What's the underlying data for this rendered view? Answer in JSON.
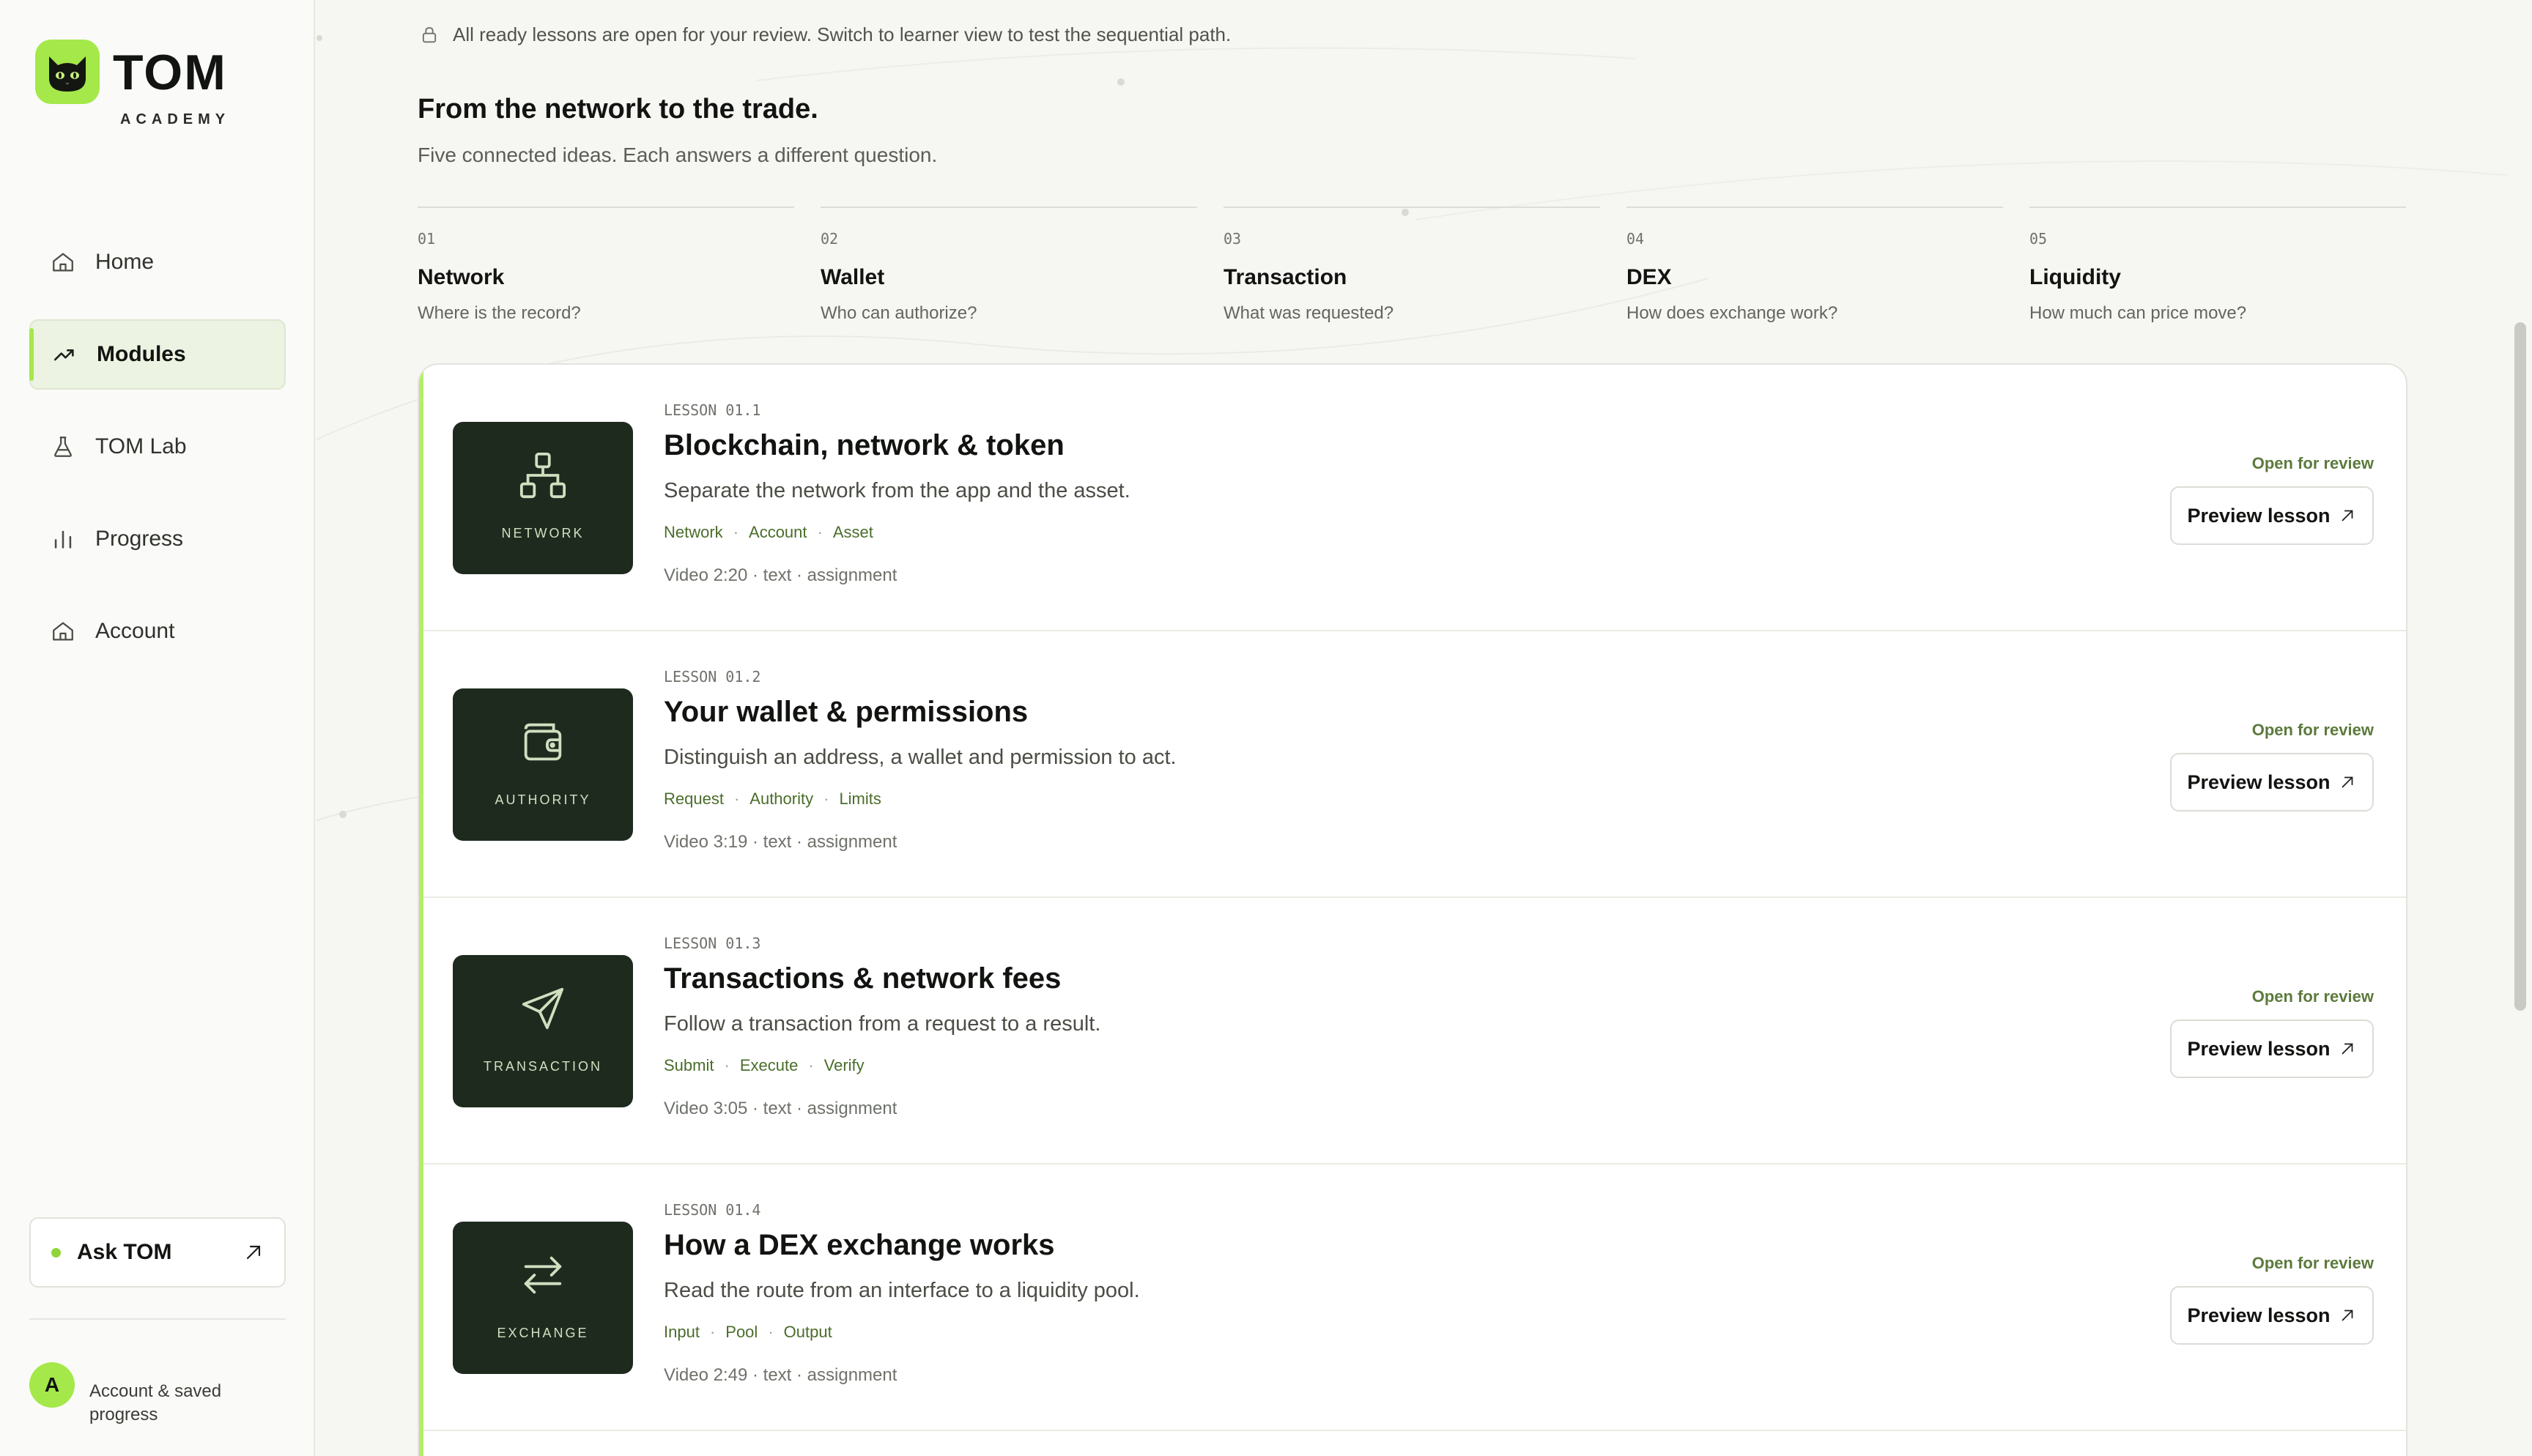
{
  "brand": {
    "name": "TOM",
    "subtitle": "ACADEMY",
    "accent": "#a4e84a"
  },
  "sidebar": {
    "items": [
      {
        "label": "Home",
        "icon": "home-icon",
        "active": false
      },
      {
        "label": "Modules",
        "icon": "trending-up-icon",
        "active": true
      },
      {
        "label": "TOM Lab",
        "icon": "flask-icon",
        "active": false
      },
      {
        "label": "Progress",
        "icon": "bar-chart-icon",
        "active": false
      },
      {
        "label": "Account",
        "icon": "home-icon",
        "active": false
      }
    ],
    "ask": {
      "label": "Ask TOM",
      "icon": "arrow-up-right-icon"
    },
    "account": {
      "avatar_initial": "A",
      "label": "Account & saved progress"
    }
  },
  "notice": {
    "icon": "lock-icon",
    "text": "All ready lessons are open for your review. Switch to learner view to test the sequential path."
  },
  "section": {
    "title": "From the network to the trade.",
    "subtitle": "Five connected ideas. Each answers a different question."
  },
  "steps": [
    {
      "num": "01",
      "title": "Network",
      "question": "Where is the record?"
    },
    {
      "num": "02",
      "title": "Wallet",
      "question": "Who can authorize?"
    },
    {
      "num": "03",
      "title": "Transaction",
      "question": "What was requested?"
    },
    {
      "num": "04",
      "title": "DEX",
      "question": "How does exchange work?"
    },
    {
      "num": "05",
      "title": "Liquidity",
      "question": "How much can price move?"
    }
  ],
  "lessons": [
    {
      "code": "LESSON 01.1",
      "title": "Blockchain, network & token",
      "description": "Separate the network from the app and the asset.",
      "tags": [
        "Network",
        "Account",
        "Asset"
      ],
      "meta": "Video 2:20 · text · assignment",
      "tile_label": "NETWORK",
      "tile_icon": "network-icon",
      "status": "Open for review",
      "button": "Preview lesson"
    },
    {
      "code": "LESSON 01.2",
      "title": "Your wallet & permissions",
      "description": "Distinguish an address, a wallet and permission to act.",
      "tags": [
        "Request",
        "Authority",
        "Limits"
      ],
      "meta": "Video 3:19 · text · assignment",
      "tile_label": "AUTHORITY",
      "tile_icon": "wallet-icon",
      "status": "Open for review",
      "button": "Preview lesson"
    },
    {
      "code": "LESSON 01.3",
      "title": "Transactions & network fees",
      "description": "Follow a transaction from a request to a result.",
      "tags": [
        "Submit",
        "Execute",
        "Verify"
      ],
      "meta": "Video 3:05 · text · assignment",
      "tile_label": "TRANSACTION",
      "tile_icon": "send-icon",
      "status": "Open for review",
      "button": "Preview lesson"
    },
    {
      "code": "LESSON 01.4",
      "title": "How a DEX exchange works",
      "description": "Read the route from an interface to a liquidity pool.",
      "tags": [
        "Input",
        "Pool",
        "Output"
      ],
      "meta": "Video 2:49 · text · assignment",
      "tile_label": "EXCHANGE",
      "tile_icon": "swap-arrows-icon",
      "status": "Open for review",
      "button": "Preview lesson"
    }
  ]
}
